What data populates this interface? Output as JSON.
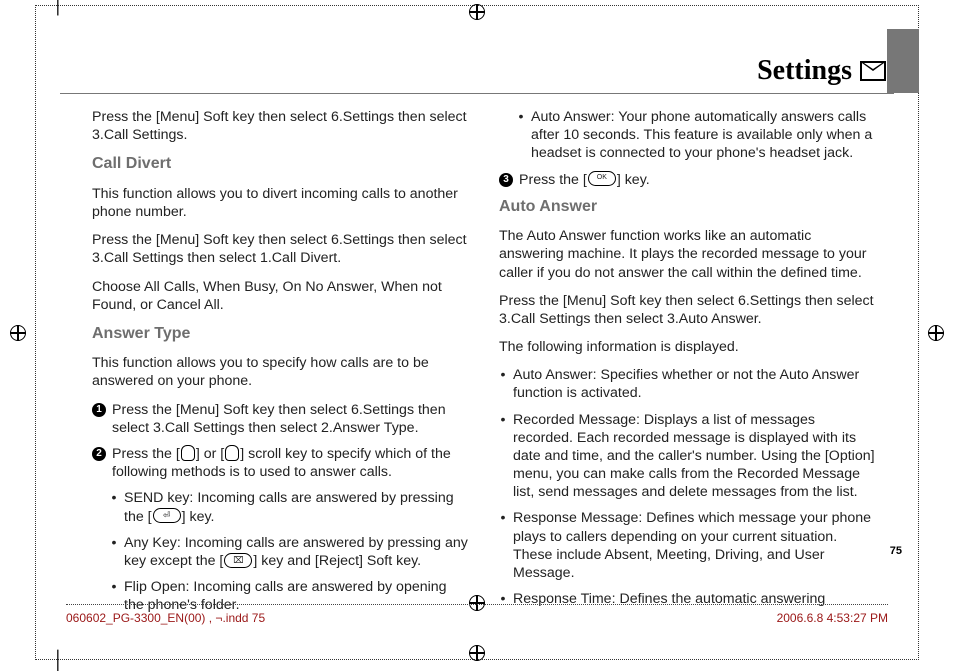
{
  "header": {
    "title": "Settings"
  },
  "page_number": "75",
  "footer": {
    "left": "060602_PG-3300_EN(00) , ¬.indd   75",
    "right": "2006.6.8   4:53:27 PM"
  },
  "left_col": {
    "intro": "Press the [Menu] Soft key then select 6.Settings then select 3.Call Settings.",
    "call_divert_h": "Call Divert",
    "call_divert_p1": "This function allows you to divert incoming calls to another phone number.",
    "call_divert_p2": "Press the [Menu] Soft key then select 6.Settings then select 3.Call Settings then select 1.Call Divert.",
    "call_divert_p3": "Choose All Calls, When Busy, On No Answer, When not Found, or Cancel All.",
    "answer_type_h": "Answer Type",
    "answer_type_p1": "This function allows you to specify how calls are to be answered on your phone.",
    "answer_type_n1": "Press the [Menu] Soft key then select 6.Settings then select 3.Call Settings then select 2.Answer Type.",
    "answer_type_n2a": "Press the [",
    "answer_type_n2b": "] or [",
    "answer_type_n2c": "] scroll key to specify which of the following methods is to used to answer calls.",
    "b_send_a": "SEND key: Incoming calls are answered by pressing the [",
    "b_send_b": "] key.",
    "b_any_a": "Any Key: Incoming calls are answered by pressing any key except the [",
    "b_any_b": "] key and [Reject] Soft key.",
    "b_flip": "Flip Open: Incoming calls are answered by opening the phone's folder."
  },
  "right_col": {
    "b_auto": "Auto Answer: Your phone automatically answers calls after 10 seconds. This feature is available only when a headset is connected to your phone's headset jack.",
    "n3a": "Press the [",
    "n3b": "] key.",
    "ok_label": "OK",
    "auto_answer_h": "Auto Answer",
    "auto_answer_p1": "The Auto Answer function works like an automatic answering machine. It plays the recorded message to your caller if you do not answer the call within the defined time.",
    "auto_answer_p2": "Press the [Menu] Soft key then select 6.Settings then select 3.Call Settings then select 3.Auto Answer.",
    "auto_answer_p3": "The following information is displayed.",
    "b_aa": "Auto Answer: Specifies whether or not the Auto Answer function is activated.",
    "b_rec": "Recorded Message: Displays a list of messages recorded. Each recorded message is displayed with its date and time, and the caller's number. Using the [Option] menu, you can make calls from the Recorded Message list, send messages and delete messages from the list.",
    "b_resp": "Response Message: Defines which message your phone plays to callers depending on your current situation. These include Absent, Meeting, Driving, and User Message.",
    "b_time": "Response Time: Defines the automatic answering"
  }
}
